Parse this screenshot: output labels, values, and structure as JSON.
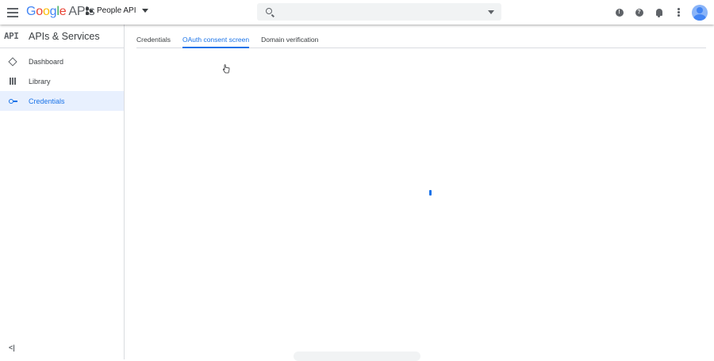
{
  "header": {
    "logo": {
      "g1": "G",
      "o1": "o",
      "o2": "o",
      "g2": "g",
      "l": "l",
      "e": "e",
      "product": "APIs"
    },
    "project_name": "People API",
    "search": {
      "value": "",
      "placeholder": ""
    },
    "icons": [
      "menu-icon",
      "project-dots-icon",
      "search-icon",
      "dropdown-caret-icon",
      "feedback-icon",
      "help-icon",
      "notifications-icon",
      "more-vert-icon",
      "avatar"
    ],
    "feedback_glyph": "!",
    "help_glyph": "?"
  },
  "sidebar": {
    "badge": "API",
    "title": "APIs & Services",
    "items": [
      {
        "label": "Dashboard",
        "icon": "dashboard-icon",
        "active": false
      },
      {
        "label": "Library",
        "icon": "library-icon",
        "active": false
      },
      {
        "label": "Credentials",
        "icon": "key-icon",
        "active": true
      }
    ],
    "collapse_glyph": "<|"
  },
  "main": {
    "tabs": [
      {
        "label": "Credentials",
        "active": false
      },
      {
        "label": "OAuth consent screen",
        "active": true
      },
      {
        "label": "Domain verification",
        "active": false
      }
    ]
  },
  "colors": {
    "accent": "#1a73e8",
    "active_bg": "#e8f0fe",
    "divider": "#dadce0",
    "icon_gray": "#5f6368"
  }
}
